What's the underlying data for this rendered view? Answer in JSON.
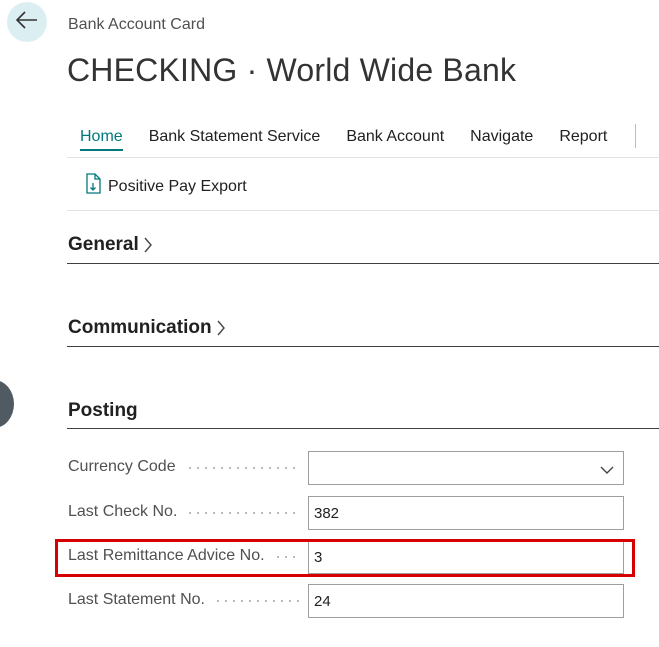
{
  "header": {
    "caption": "Bank Account Card",
    "title": "CHECKING · World Wide Bank"
  },
  "icons": {
    "back": "arrow-left-icon",
    "export": "document-export-icon",
    "chevron_right": "chevron-right-icon",
    "chevron_down": "chevron-down-icon"
  },
  "action_bar": {
    "tabs": [
      {
        "label": "Home",
        "active": true
      },
      {
        "label": "Bank Statement Service"
      },
      {
        "label": "Bank Account"
      },
      {
        "label": "Navigate"
      },
      {
        "label": "Report"
      }
    ],
    "sub_actions": [
      {
        "label": "Positive Pay Export"
      }
    ]
  },
  "sections": {
    "general": {
      "title": "General"
    },
    "communication": {
      "title": "Communication"
    },
    "posting": {
      "title": "Posting",
      "fields": [
        {
          "label": "Currency Code",
          "value": "",
          "type": "select"
        },
        {
          "label": "Last Check No.",
          "value": "382"
        },
        {
          "label": "Last Remittance Advice No.",
          "value": "3",
          "highlighted": true
        },
        {
          "label": "Last Statement No.",
          "value": "24"
        }
      ]
    }
  },
  "colors": {
    "accent": "#00797c",
    "highlight_border": "#d60000",
    "back_button_bg": "#dbeef1"
  }
}
